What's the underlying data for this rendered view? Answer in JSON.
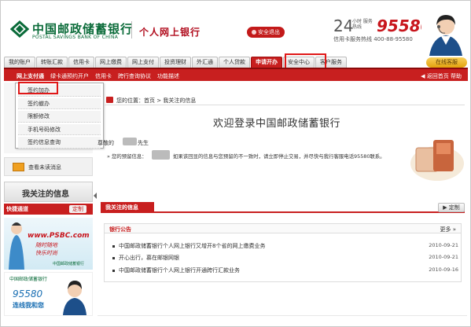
{
  "header": {
    "bank_name_cn": "中国邮政储蓄银行",
    "bank_name_en": "POSTAL SAVINGS BANK OF CHINA",
    "site_title": "个人网上银行",
    "logout_label": "安全退出",
    "hotline_num": "24",
    "hotline_label": "小时 服务热线",
    "hotline_phone": "95580",
    "card_phone": "信用卡服务热线  400-88-95580"
  },
  "nav": {
    "tabs": [
      "我的账户",
      "转账汇款",
      "信用卡",
      "网上缴费",
      "网上支付",
      "投资理财",
      "外汇通",
      "个人贷款",
      "申请开办",
      "安全中心",
      "客户服务"
    ],
    "active_index": 8,
    "online_service": "在线客服"
  },
  "subnav": {
    "items": [
      "网上支付通",
      "绿卡通预约开户",
      "信用卡",
      "跨行查询协议",
      "功能描述"
    ],
    "right": "◀ 返回首页   帮助"
  },
  "dropdown": {
    "items": [
      "签约加办",
      "签约撤办",
      "限额修改",
      "手机号码修改",
      "签约信息查询"
    ]
  },
  "sidebar": {
    "unread_messages": "查看未读消息",
    "focus_title": "我关注的信息",
    "quick_channel": "快捷通道",
    "customize": "定制"
  },
  "ads": {
    "psbc_url": "www.PSBC.com",
    "line1": "随时随地",
    "line2": "快乐时尚",
    "footer": "中国邮政储蓄银行",
    "ad2_bank": "中国邮政储蓄银行",
    "ad2_number": "95580",
    "ad2_slogan": "连线我和您"
  },
  "main": {
    "location": "您的位置：首页 > 我关注的信息",
    "welcome": "欢迎登录中国邮政储蓄银行",
    "greeting_prefix": "尊敬的",
    "greeting_suffix": "先生",
    "hint_prefix": "»  您的预留信息：",
    "hint_rest": "如果该回显的信息与您预留的不一致时，请立即停止交易，并尽快与我行客服电话95580联系。",
    "focus_tab": "我关注的信息",
    "customize": "▶ 定制"
  },
  "notice": {
    "title": "银行公告",
    "more": "更多 »",
    "items": [
      {
        "text": "中国邮政储蓄银行个人网上银行又增开8个省的网上缴费业务",
        "date": "2010-09-21"
      },
      {
        "text": "开心出行，慕在邮银网银",
        "date": "2010-09-21"
      },
      {
        "text": "中国邮政储蓄银行个人网上银行开通跨行汇款业务",
        "date": "2010-09-16"
      }
    ]
  },
  "colors": {
    "brand_green": "#0a6b39",
    "brand_red": "#c81f1f",
    "highlight": "#e01818"
  }
}
